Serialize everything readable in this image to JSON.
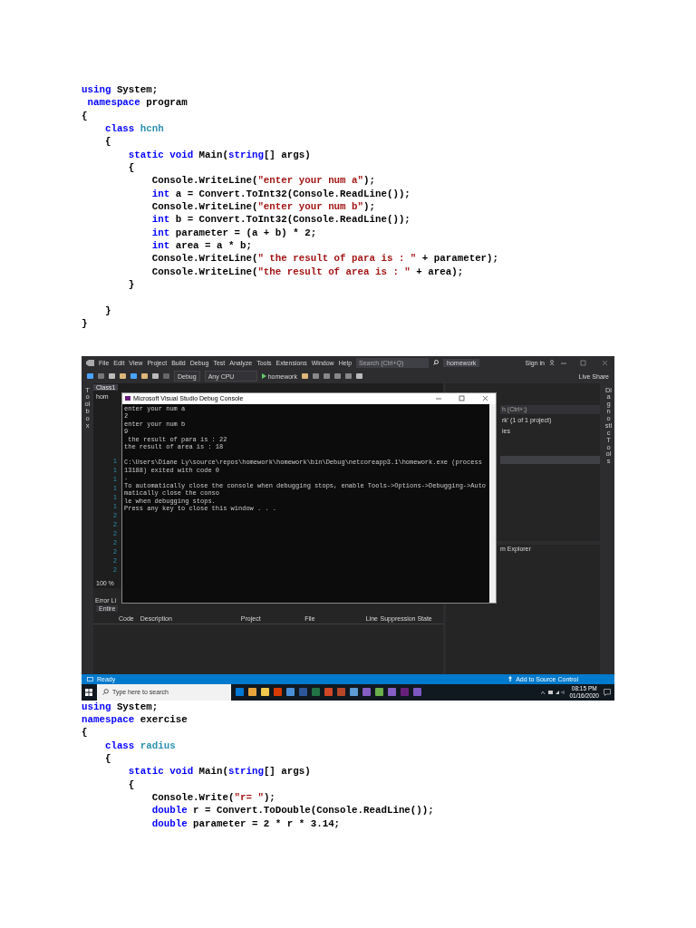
{
  "code_top": {
    "lines": [
      {
        "tokens": [
          {
            "kind": "keyword",
            "text": "using"
          },
          {
            "kind": "plain",
            "text": " System;"
          }
        ]
      },
      {
        "tokens": [
          {
            "kind": "keyword",
            "text": " namespace"
          },
          {
            "kind": "plain",
            "text": " program"
          }
        ]
      },
      {
        "tokens": [
          {
            "kind": "plain",
            "text": "{"
          }
        ]
      },
      {
        "tokens": [
          {
            "kind": "keyword",
            "text": "    class"
          },
          {
            "kind": "type",
            "text": " hcnh"
          }
        ]
      },
      {
        "tokens": [
          {
            "kind": "plain",
            "text": "    {"
          }
        ]
      },
      {
        "tokens": [
          {
            "kind": "keyword",
            "text": "        static void"
          },
          {
            "kind": "plain",
            "text": " Main("
          },
          {
            "kind": "keyword",
            "text": "string"
          },
          {
            "kind": "plain",
            "text": "[] args)"
          }
        ]
      },
      {
        "tokens": [
          {
            "kind": "plain",
            "text": "        {"
          }
        ]
      },
      {
        "tokens": [
          {
            "kind": "plain",
            "text": "            Console.WriteLine("
          },
          {
            "kind": "string",
            "text": "\"enter your num a\""
          },
          {
            "kind": "plain",
            "text": ");"
          }
        ]
      },
      {
        "tokens": [
          {
            "kind": "keyword",
            "text": "            int"
          },
          {
            "kind": "plain",
            "text": " a = Convert.ToInt32(Console.ReadLine());"
          }
        ]
      },
      {
        "tokens": [
          {
            "kind": "plain",
            "text": "            Console.WriteLine("
          },
          {
            "kind": "string",
            "text": "\"enter your num b\""
          },
          {
            "kind": "plain",
            "text": ");"
          }
        ]
      },
      {
        "tokens": [
          {
            "kind": "keyword",
            "text": "            int"
          },
          {
            "kind": "plain",
            "text": " b = Convert.ToInt32(Console.ReadLine());"
          }
        ]
      },
      {
        "tokens": [
          {
            "kind": "keyword",
            "text": "            int"
          },
          {
            "kind": "plain",
            "text": " parameter = (a + b) * 2;"
          }
        ]
      },
      {
        "tokens": [
          {
            "kind": "keyword",
            "text": "            int"
          },
          {
            "kind": "plain",
            "text": " area = a * b;"
          }
        ]
      },
      {
        "tokens": [
          {
            "kind": "plain",
            "text": "            Console.WriteLine("
          },
          {
            "kind": "string",
            "text": "\" the result of para is : \""
          },
          {
            "kind": "plain",
            "text": " + parameter);"
          }
        ]
      },
      {
        "tokens": [
          {
            "kind": "plain",
            "text": "            Console.WriteLine("
          },
          {
            "kind": "string",
            "text": "\"the result of area is : \""
          },
          {
            "kind": "plain",
            "text": " + area);"
          }
        ]
      },
      {
        "tokens": [
          {
            "kind": "plain",
            "text": "        }"
          }
        ]
      },
      {
        "tokens": [
          {
            "kind": "plain",
            "text": "    }"
          }
        ],
        "space_before": true
      },
      {
        "tokens": [
          {
            "kind": "plain",
            "text": "}"
          }
        ]
      }
    ]
  },
  "screenshot": {
    "menu": [
      "File",
      "Edit",
      "View",
      "Project",
      "Build",
      "Debug",
      "Test",
      "Analyze",
      "Tools",
      "Extensions",
      "Window",
      "Help"
    ],
    "search": {
      "placeholder": "Search (Ctrl+Q)"
    },
    "solution_name": "homework",
    "sign_in": "Sign in",
    "toolbar": {
      "configuration": "Debug",
      "platform": "Any CPU",
      "start": "homework",
      "live_share": "Live Share"
    },
    "toolbox_tab": "Toolbox",
    "diagnostic_tab": "Diagnostic Tools",
    "editor": {
      "tab": "Class1",
      "navigation": "hom",
      "line_numbers": [
        "1",
        "1",
        "1",
        "1",
        "1",
        "1",
        "2",
        "2",
        "2",
        "2",
        "2",
        "2",
        "2"
      ],
      "zoom": "100 %"
    },
    "solution_explorer": {
      "search_placeholder": "h (Ctrl+;)",
      "rows": [
        "rk' (1 of 1 project)",
        "ies"
      ]
    },
    "team_explorer": {
      "title": "m Explorer"
    },
    "error_list": {
      "title": "Error Li",
      "scope": "Entire",
      "columns": [
        "Code",
        "Description",
        "Project",
        "File",
        "Line",
        "Suppression State"
      ]
    },
    "status_bar": {
      "text": "Ready",
      "source_control": "Add to Source Control"
    },
    "console": {
      "title": "Microsoft Visual Studio Debug Console",
      "lines": [
        {
          "text": "enter your num a"
        },
        {
          "text": "2"
        },
        {
          "text": "enter your num b"
        },
        {
          "text": "9"
        },
        {
          "text": " the result of para is : 22"
        },
        {
          "text": "the result of area is : 18"
        },
        {
          "kind": "blank"
        },
        {
          "text": "C:\\Users\\Diane Ly\\source\\repos\\homework\\homework\\bin\\Debug\\netcoreapp3.1\\homework.exe (process 13188) exited with code 0"
        },
        {
          "text": "."
        },
        {
          "text": "To automatically close the console when debugging stops, enable Tools->Options->Debugging->Automatically close the conso"
        },
        {
          "text": "le when debugging stops."
        },
        {
          "text": "Press any key to close this window . . ."
        }
      ]
    },
    "taskbar": {
      "search_placeholder": "Type here to search",
      "time": "08:15 PM",
      "date": "01/16/2020"
    }
  },
  "code_bottom": {
    "lines": [
      {
        "tokens": [
          {
            "kind": "keyword",
            "text": "using"
          },
          {
            "kind": "plain",
            "text": " System;"
          }
        ]
      },
      {
        "tokens": [
          {
            "kind": "keyword",
            "text": "namespace"
          },
          {
            "kind": "plain",
            "text": " exercise"
          }
        ]
      },
      {
        "tokens": [
          {
            "kind": "plain",
            "text": "{"
          }
        ]
      },
      {
        "tokens": [
          {
            "kind": "keyword",
            "text": "    class"
          },
          {
            "kind": "type",
            "text": " radius"
          }
        ]
      },
      {
        "tokens": [
          {
            "kind": "plain",
            "text": "    {"
          }
        ]
      },
      {
        "tokens": [
          {
            "kind": "keyword",
            "text": "        static void"
          },
          {
            "kind": "plain",
            "text": " Main("
          },
          {
            "kind": "keyword",
            "text": "string"
          },
          {
            "kind": "plain",
            "text": "[] args)"
          }
        ]
      },
      {
        "tokens": [
          {
            "kind": "plain",
            "text": "        {"
          }
        ]
      },
      {
        "tokens": [
          {
            "kind": "plain",
            "text": "            Console.Write("
          },
          {
            "kind": "string",
            "text": "\"r= \""
          },
          {
            "kind": "plain",
            "text": ");"
          }
        ]
      },
      {
        "tokens": [
          {
            "kind": "keyword",
            "text": "            double"
          },
          {
            "kind": "plain",
            "text": " r = Convert.ToDouble(Console.ReadLine());"
          }
        ]
      },
      {
        "tokens": [
          {
            "kind": "keyword",
            "text": "            double"
          },
          {
            "kind": "plain",
            "text": " parameter = 2 * r * 3.14;"
          }
        ]
      }
    ]
  }
}
